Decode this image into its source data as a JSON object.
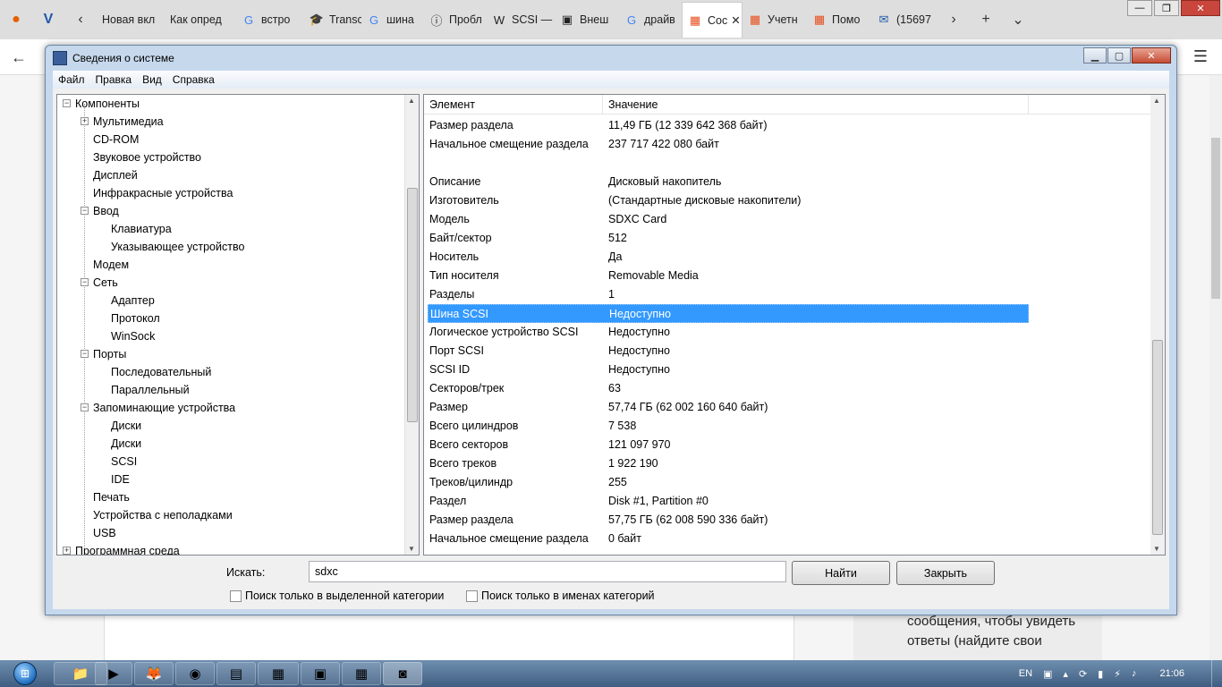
{
  "browser": {
    "tabs": [
      {
        "label": "Новая вкл",
        "icon": "page-icon"
      },
      {
        "label": "Как опред",
        "icon": "page-icon"
      },
      {
        "label": "встро",
        "icon": "google-icon"
      },
      {
        "label": "Transc",
        "icon": "graduation-cap-icon"
      },
      {
        "label": "шина",
        "icon": "google-icon"
      },
      {
        "label": "Пробл",
        "icon": "info-icon"
      },
      {
        "label": "SCSI —",
        "icon": "wikipedia-icon"
      },
      {
        "label": "Внеш",
        "icon": "rs-icon"
      },
      {
        "label": "драйв",
        "icon": "google-icon"
      },
      {
        "label": "Сос",
        "icon": "microsoft-icon",
        "active": true
      },
      {
        "label": "Учетн",
        "icon": "microsoft-icon"
      },
      {
        "label": "Помо",
        "icon": "microsoft-icon"
      },
      {
        "label": "(15697",
        "icon": "mail-icon"
      }
    ]
  },
  "page": {
    "side_text": "сообщения, чтобы увидеть ответы (найдите свои"
  },
  "window": {
    "title": "Сведения о системе",
    "menu": [
      "Файл",
      "Правка",
      "Вид",
      "Справка"
    ]
  },
  "tree": [
    {
      "label": "Компоненты",
      "level": 0,
      "box": "−"
    },
    {
      "label": "Мультимедиа",
      "level": 1,
      "box": "+"
    },
    {
      "label": "CD-ROM",
      "level": 1
    },
    {
      "label": "Звуковое устройство",
      "level": 1
    },
    {
      "label": "Дисплей",
      "level": 1
    },
    {
      "label": "Инфракрасные устройства",
      "level": 1
    },
    {
      "label": "Ввод",
      "level": 1,
      "box": "−"
    },
    {
      "label": "Клавиатура",
      "level": 2
    },
    {
      "label": "Указывающее устройство",
      "level": 2
    },
    {
      "label": "Модем",
      "level": 1
    },
    {
      "label": "Сеть",
      "level": 1,
      "box": "−"
    },
    {
      "label": "Адаптер",
      "level": 2
    },
    {
      "label": "Протокол",
      "level": 2
    },
    {
      "label": "WinSock",
      "level": 2
    },
    {
      "label": "Порты",
      "level": 1,
      "box": "−"
    },
    {
      "label": "Последовательный",
      "level": 2
    },
    {
      "label": "Параллельный",
      "level": 2
    },
    {
      "label": "Запоминающие устройства",
      "level": 1,
      "box": "−"
    },
    {
      "label": "Диски",
      "level": 2
    },
    {
      "label": "Диски",
      "level": 2
    },
    {
      "label": "SCSI",
      "level": 2
    },
    {
      "label": "IDE",
      "level": 2
    },
    {
      "label": "Печать",
      "level": 1
    },
    {
      "label": "Устройства с неполадками",
      "level": 1
    },
    {
      "label": "USB",
      "level": 1
    },
    {
      "label": "Программная среда",
      "level": 0,
      "box": "+"
    }
  ],
  "list": {
    "col_element": "Элемент",
    "col_value": "Значение",
    "rows": [
      {
        "k": "Размер раздела",
        "v": "11,49 ГБ (12 339 642 368 байт)"
      },
      {
        "k": "Начальное смещение раздела",
        "v": "237 717 422 080 байт"
      },
      {
        "k": "",
        "v": ""
      },
      {
        "k": "Описание",
        "v": "Дисковый накопитель"
      },
      {
        "k": "Изготовитель",
        "v": "(Стандартные дисковые накопители)"
      },
      {
        "k": "Модель",
        "v": "SDXC Card"
      },
      {
        "k": "Байт/сектор",
        "v": "512"
      },
      {
        "k": "Носитель",
        "v": "Да"
      },
      {
        "k": "Тип носителя",
        "v": "Removable Media"
      },
      {
        "k": "Разделы",
        "v": "1"
      },
      {
        "k": "Шина SCSI",
        "v": "Недоступно",
        "selected": true
      },
      {
        "k": "Логическое устройство SCSI",
        "v": "Недоступно"
      },
      {
        "k": "Порт SCSI",
        "v": "Недоступно"
      },
      {
        "k": "SCSI ID",
        "v": "Недоступно"
      },
      {
        "k": "Секторов/трек",
        "v": "63"
      },
      {
        "k": "Размер",
        "v": "57,74 ГБ (62 002 160 640 байт)"
      },
      {
        "k": "Всего цилиндров",
        "v": "7 538"
      },
      {
        "k": "Всего секторов",
        "v": "121 097 970"
      },
      {
        "k": "Всего треков",
        "v": "1 922 190"
      },
      {
        "k": "Треков/цилиндр",
        "v": "255"
      },
      {
        "k": "Раздел",
        "v": "Disk #1, Partition #0"
      },
      {
        "k": "Размер раздела",
        "v": "57,75 ГБ (62 008 590 336 байт)"
      },
      {
        "k": "Начальное смещение раздела",
        "v": "0 байт"
      }
    ]
  },
  "search": {
    "label": "Искать:",
    "value": "sdxc",
    "find_button": "Найти",
    "close_button": "Закрыть",
    "check_selected": "Поиск только в выделенной категории",
    "check_names": "Поиск только в именах категорий"
  },
  "taskbar": {
    "lang": "EN",
    "clock": "21:06"
  },
  "colors": {
    "selection": "#3399ff",
    "window_frame": "#c6d8ec"
  }
}
